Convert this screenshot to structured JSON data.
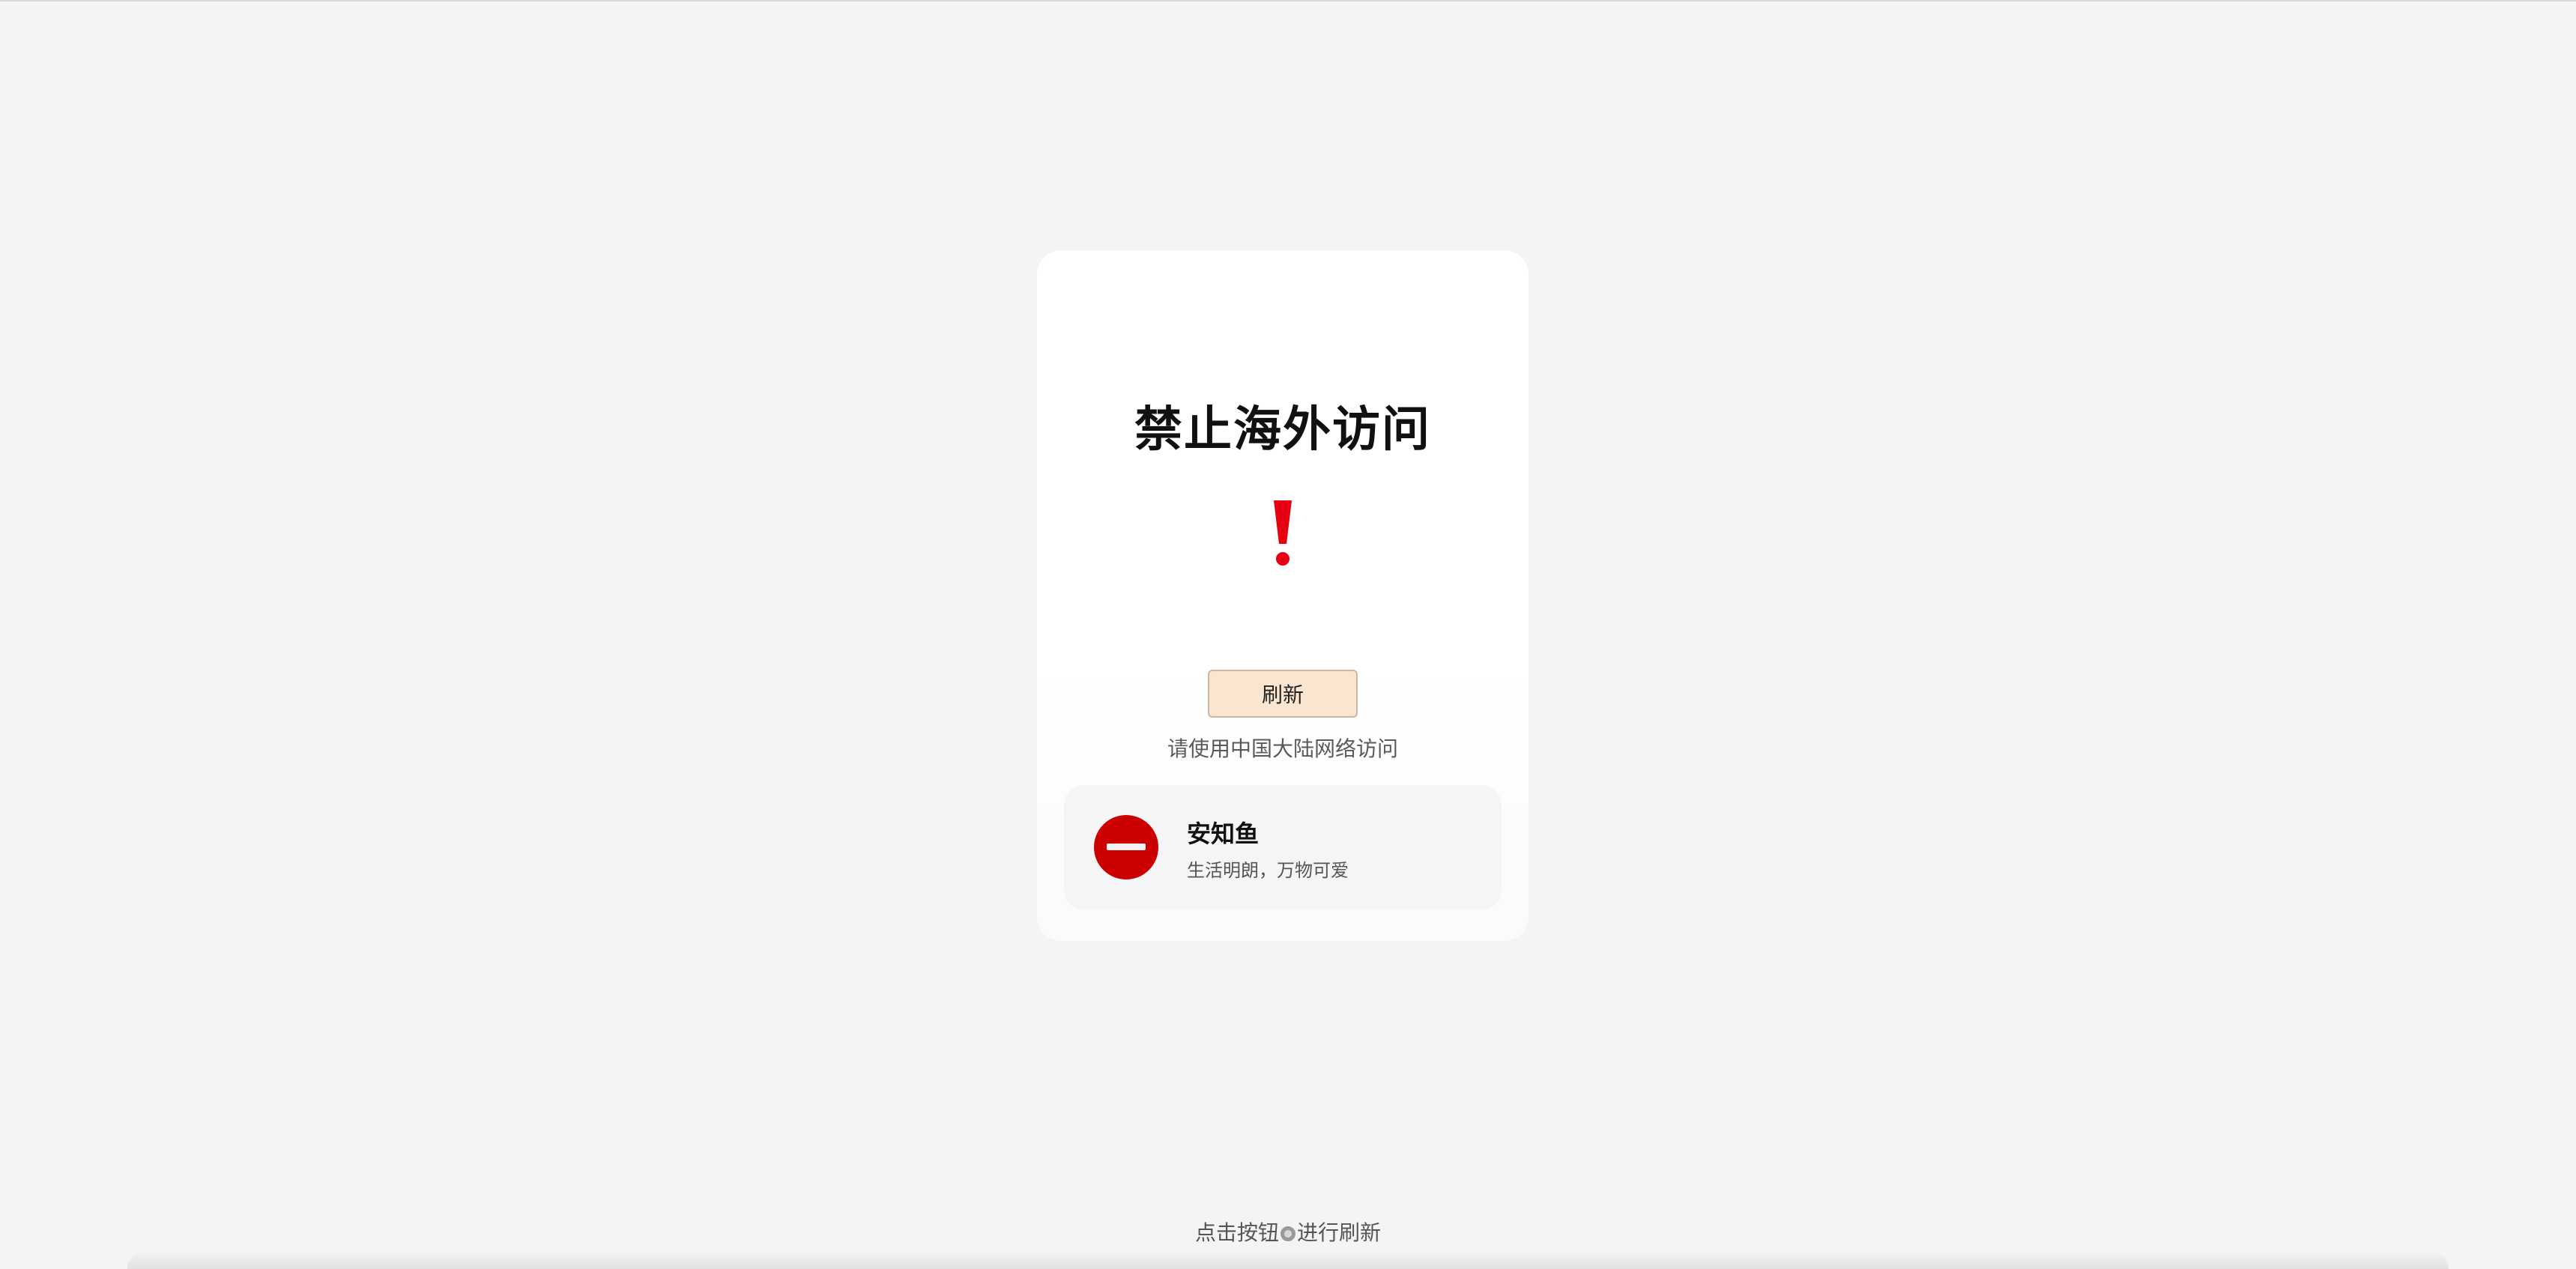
{
  "card": {
    "title": "禁止海外访问",
    "warning_icon": "exclamation-icon",
    "warning_color": "#e60012",
    "refresh_label": "刷新",
    "hint": "请使用中国大陆网络访问",
    "profile": {
      "name": "安知鱼",
      "motto": "生活明朗，万物可爱",
      "avatar_icon": "no-entry-icon",
      "avatar_color": "#cc0000"
    }
  },
  "footer": {
    "prefix": "点击按钮",
    "icon": "refresh-icon",
    "suffix": "进行刷新"
  },
  "colors": {
    "background": "#f4f4f5",
    "card": "#ffffff",
    "button": "#fae6d0"
  }
}
